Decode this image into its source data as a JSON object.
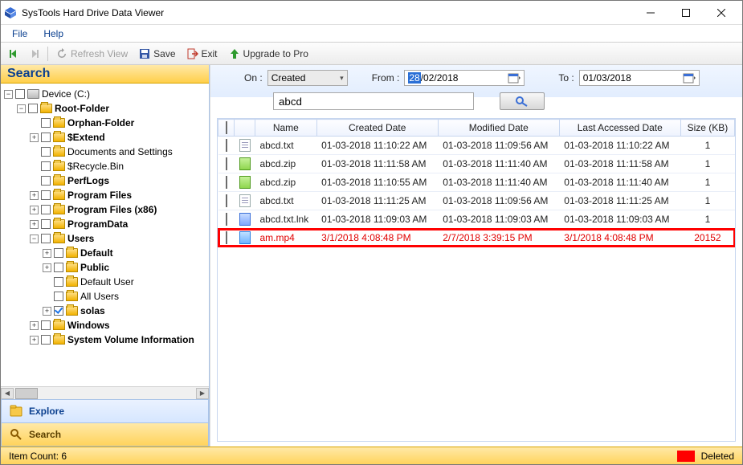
{
  "window": {
    "title": "SysTools Hard Drive Data Viewer"
  },
  "menu": {
    "file": "File",
    "help": "Help"
  },
  "toolbar": {
    "refresh": "Refresh View",
    "save": "Save",
    "exit": "Exit",
    "upgrade": "Upgrade to Pro"
  },
  "left": {
    "search_header": "Search",
    "explore_tab": "Explore",
    "search_tab": "Search"
  },
  "tree": {
    "root": "Device (C:)",
    "items": [
      "Root-Folder",
      "Orphan-Folder",
      "$Extend",
      "Documents and Settings",
      "$Recycle.Bin",
      "PerfLogs",
      "Program Files",
      "Program Files (x86)",
      "ProgramData",
      "Users",
      "Default",
      "Public",
      "Default User",
      "All Users",
      "solas",
      "Windows",
      "System Volume Information"
    ]
  },
  "filter": {
    "on_label": "On :",
    "on_value": "Created",
    "from_label": "From :",
    "from_sel": "28",
    "from_rest": "/02/2018",
    "to_label": "To :",
    "to_value": "01/03/2018",
    "search_text": "abcd"
  },
  "table": {
    "headers": {
      "name": "Name",
      "created": "Created Date",
      "modified": "Modified Date",
      "accessed": "Last Accessed Date",
      "size": "Size (KB)"
    },
    "rows": [
      {
        "icon": "txt",
        "name": "abcd.txt",
        "created": "01-03-2018 11:10:22 AM",
        "modified": "01-03-2018 11:09:56 AM",
        "accessed": "01-03-2018 11:10:22 AM",
        "size": "1",
        "deleted": false
      },
      {
        "icon": "zip",
        "name": "abcd.zip",
        "created": "01-03-2018 11:11:58 AM",
        "modified": "01-03-2018 11:11:40 AM",
        "accessed": "01-03-2018 11:11:58 AM",
        "size": "1",
        "deleted": false
      },
      {
        "icon": "zip",
        "name": "abcd.zip",
        "created": "01-03-2018 11:10:55 AM",
        "modified": "01-03-2018 11:11:40 AM",
        "accessed": "01-03-2018 11:11:40 AM",
        "size": "1",
        "deleted": false
      },
      {
        "icon": "txt",
        "name": "abcd.txt",
        "created": "01-03-2018 11:11:25 AM",
        "modified": "01-03-2018 11:09:56 AM",
        "accessed": "01-03-2018 11:11:25 AM",
        "size": "1",
        "deleted": false
      },
      {
        "icon": "lnk",
        "name": "abcd.txt.lnk",
        "created": "01-03-2018 11:09:03 AM",
        "modified": "01-03-2018 11:09:03 AM",
        "accessed": "01-03-2018 11:09:03 AM",
        "size": "1",
        "deleted": false
      },
      {
        "icon": "mp4",
        "name": "am.mp4",
        "created": "3/1/2018 4:08:48 PM",
        "modified": "2/7/2018 3:39:15 PM",
        "accessed": "3/1/2018 4:08:48 PM",
        "size": "20152",
        "deleted": true
      }
    ]
  },
  "status": {
    "count": "Item Count: 6",
    "deleted_label": "Deleted"
  }
}
